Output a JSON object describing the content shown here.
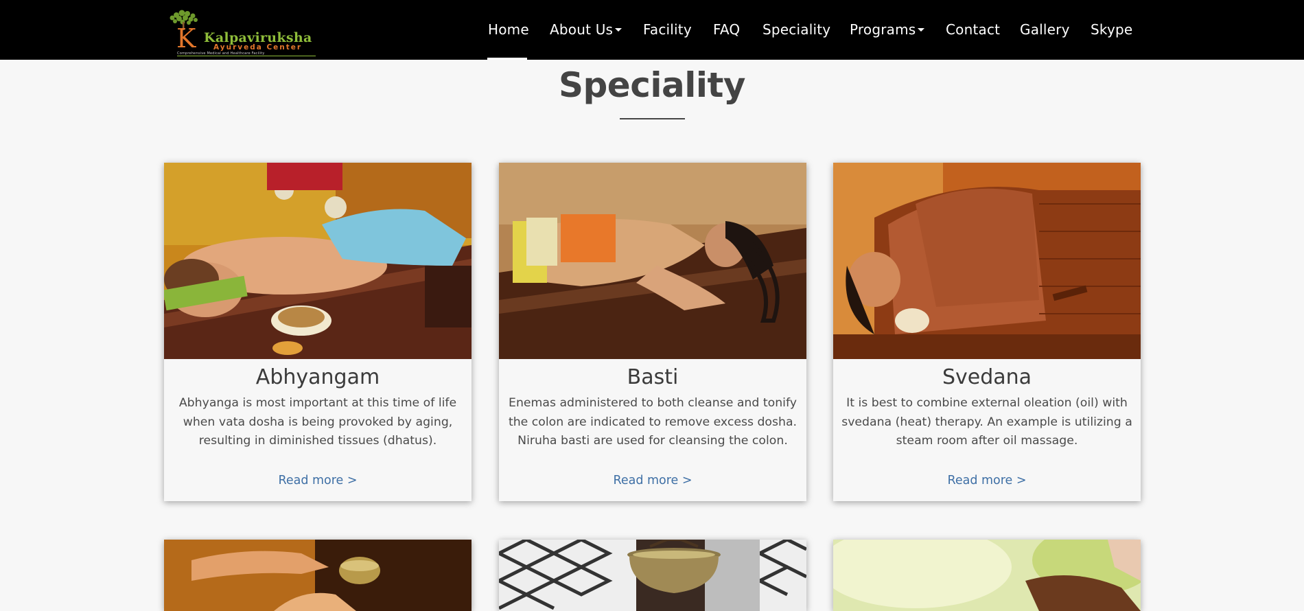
{
  "brand": {
    "title": "Kalpaviruksha",
    "subtitle": "Ayurveda Center",
    "tagline": "Comprehensive Medical and Healthcare Facility"
  },
  "nav": {
    "items": [
      {
        "label": "Home",
        "active": true
      },
      {
        "label": "About Us",
        "dropdown": true
      },
      {
        "label": "Facility"
      },
      {
        "label": "FAQ"
      },
      {
        "label": "Speciality"
      },
      {
        "label": "Programs",
        "dropdown": true
      },
      {
        "label": "Contact"
      },
      {
        "label": "Gallery"
      },
      {
        "label": "Skype"
      }
    ]
  },
  "section": {
    "title": "Speciality"
  },
  "cards": [
    {
      "title": "Abhyangam",
      "text": "Abhyanga is most important at this time of life when vata dosha is being provoked by aging, resulting in diminished tissues (dhatus).",
      "link": "Read more >"
    },
    {
      "title": "Basti",
      "text": "Enemas administered to both cleanse and tonify the colon are indicated to remove excess dosha. Niruha basti are used for cleansing the colon.",
      "link": "Read more >"
    },
    {
      "title": "Svedana",
      "text": "It is best to combine external oleation (oil) with svedana (heat) therapy. An example is utilizing a steam room after oil massage.",
      "link": "Read more >"
    }
  ],
  "colors": {
    "navbar": "#000000",
    "page_bg": "#f7f7f7",
    "link": "#3e6fa5",
    "logo_orange": "#e2762b",
    "logo_green": "#8fbd3a"
  }
}
